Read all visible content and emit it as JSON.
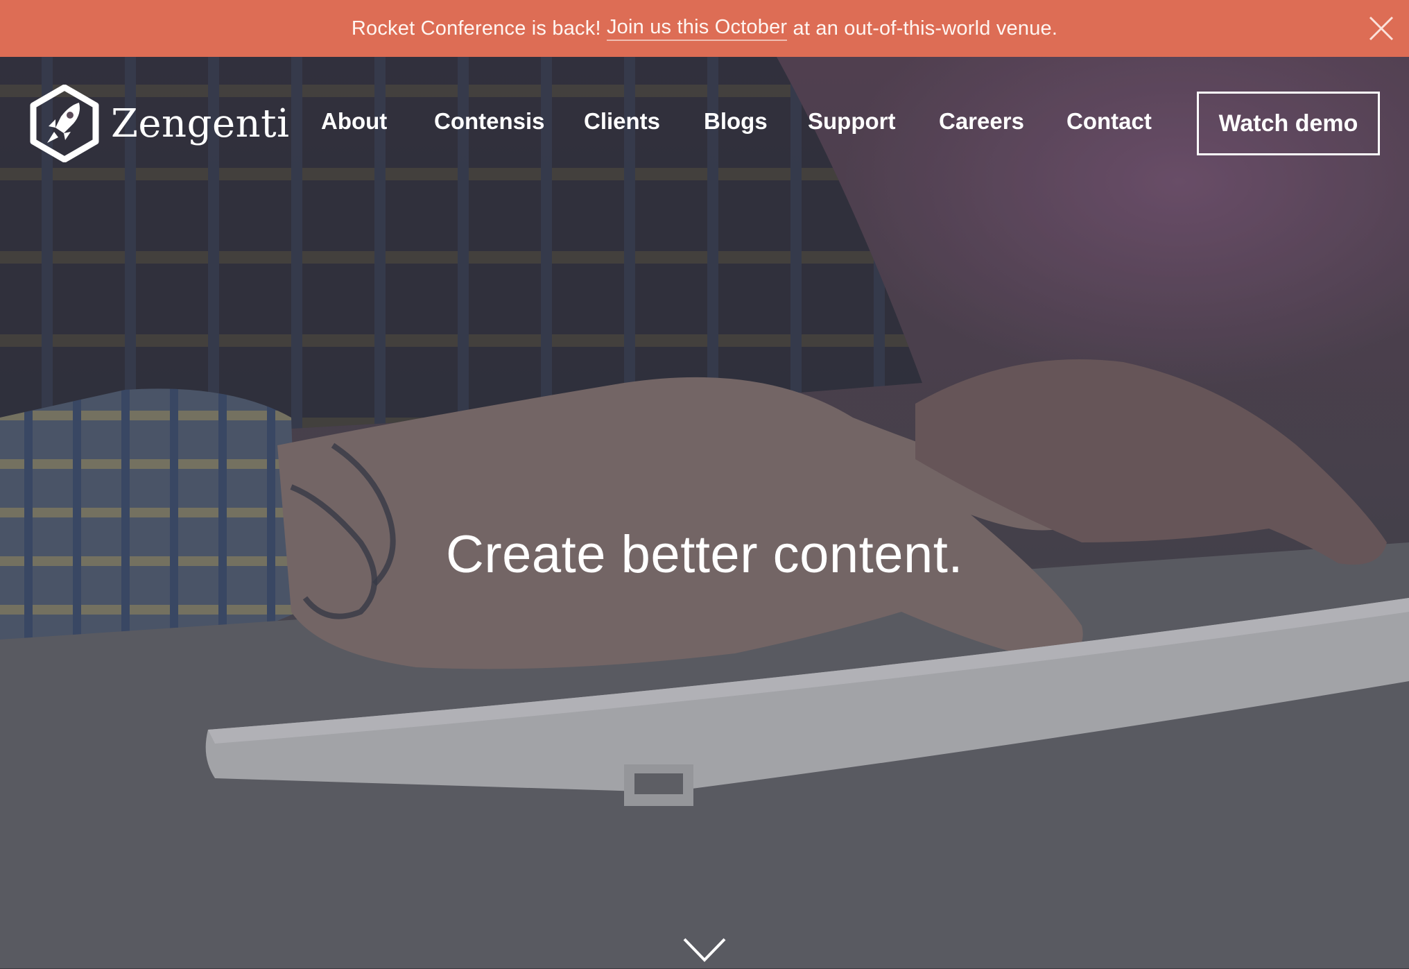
{
  "banner": {
    "text_before": "Rocket Conference is back! ",
    "link_text": "Join us this October",
    "text_after": " at an out-of-this-world venue.",
    "background_color": "#dd6d55",
    "close_icon": "close-icon"
  },
  "header": {
    "logo_icon": "rocket-hexagon-icon",
    "brand_name": "Zengenti",
    "nav_items": [
      {
        "label": "About"
      },
      {
        "label": "Contensis"
      },
      {
        "label": "Clients"
      },
      {
        "label": "Blogs"
      },
      {
        "label": "Support"
      },
      {
        "label": "Careers"
      },
      {
        "label": "Contact"
      }
    ],
    "cta_label": "Watch demo"
  },
  "hero": {
    "headline": "Create better content.",
    "scroll_icon": "chevron-down-icon",
    "background_image": "hands typing on a keyboard"
  }
}
